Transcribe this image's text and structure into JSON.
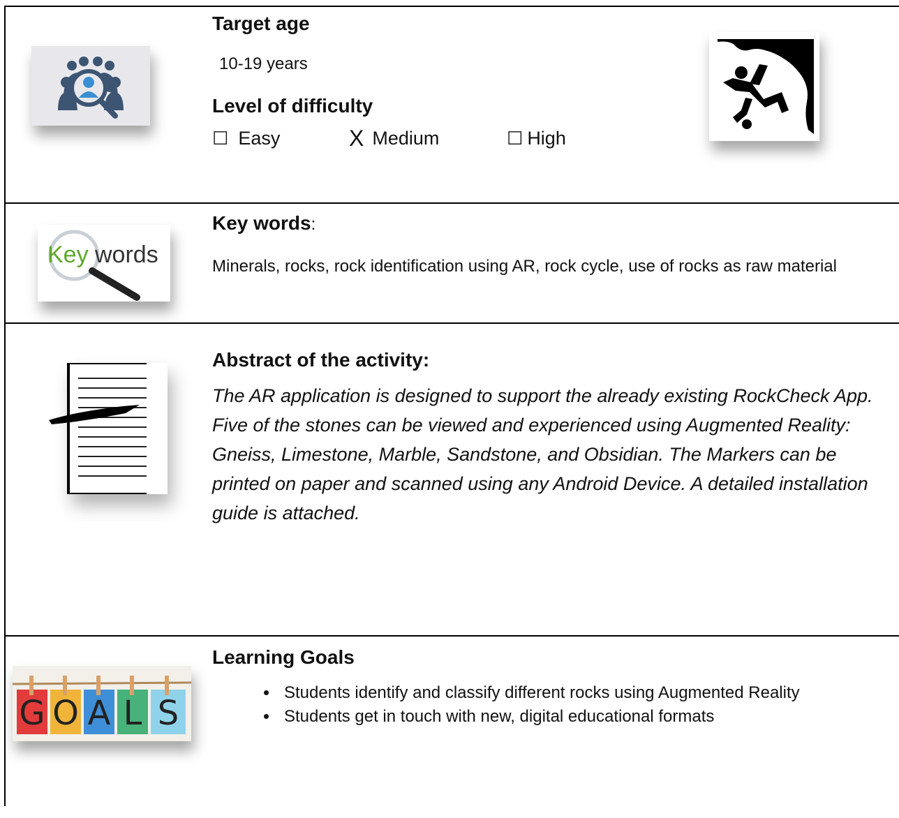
{
  "target_age": {
    "heading": "Target age",
    "value": "10-19 years"
  },
  "difficulty": {
    "heading": "Level of difficulty",
    "options": [
      {
        "mark": "☐",
        "label": "Easy"
      },
      {
        "mark": "X",
        "label": "Medium"
      },
      {
        "mark": "☐",
        "label": "High"
      }
    ]
  },
  "keywords": {
    "heading": "Key words",
    "colon": ":",
    "text": "Minerals, rocks, rock identification using AR, rock cycle, use of rocks as raw material",
    "logo_key": "Key",
    "logo_words": "words"
  },
  "abstract": {
    "heading": "Abstract of the activity:",
    "text": "The AR application is designed to support the already existing RockCheck App. Five of the stones can be viewed and experienced using Augmented Reality: Gneiss, Limestone, Marble, Sandstone, and Obsidian. The Markers can be printed on paper and scanned using any Android Device. A detailed installation guide is attached."
  },
  "goals": {
    "heading": "Learning Goals",
    "items": [
      "Students identify and classify different rocks using Augmented Reality",
      "Students get in touch with new, digital educational formats"
    ],
    "card_letters": [
      "G",
      "O",
      "A",
      "L",
      "S"
    ]
  },
  "colors": {
    "target_icon": "#3d5573",
    "target_bg": "#e8e8ec",
    "keyword_green": "#5fa829",
    "goal_cards": [
      "#e23b3b",
      "#f0b43a",
      "#3f8fd8",
      "#47b27a",
      "#8fd3ea"
    ]
  }
}
